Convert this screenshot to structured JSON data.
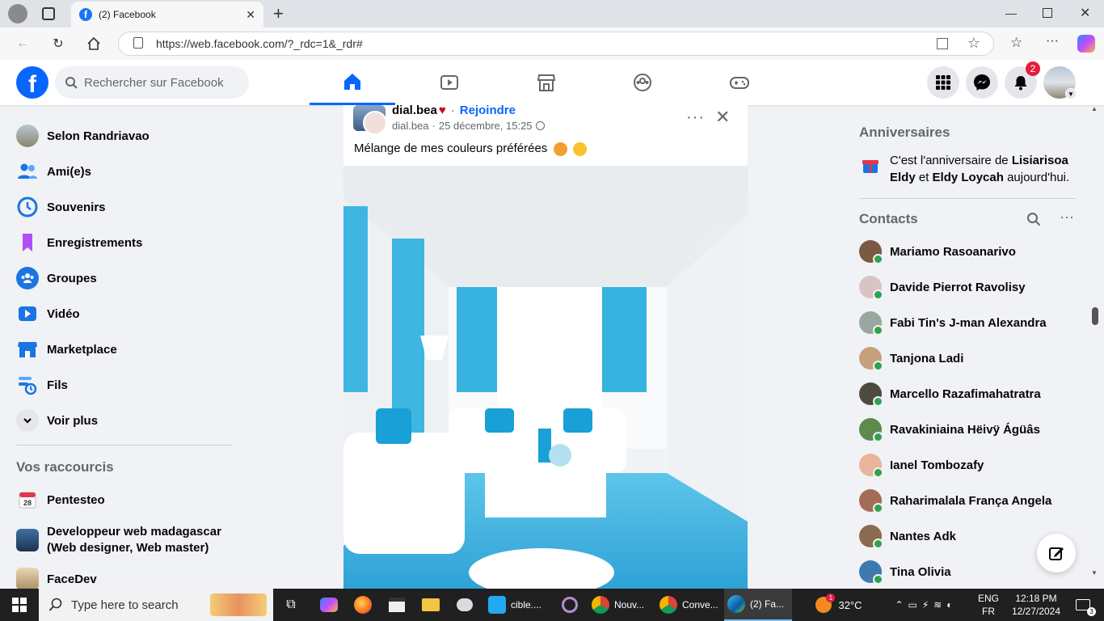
{
  "browser": {
    "tab_title": "(2) Facebook",
    "url": "https://web.facebook.com/?_rdc=1&_rdr#"
  },
  "fb": {
    "search_placeholder": "Rechercher sur Facebook",
    "notification_count": "2",
    "brand_color": "#0866ff"
  },
  "left_nav": {
    "items": [
      {
        "label": "Selon Randriavao",
        "icon": "profile-avatar"
      },
      {
        "label": "Ami(e)s",
        "icon": "friends-icon"
      },
      {
        "label": "Souvenirs",
        "icon": "memories-icon"
      },
      {
        "label": "Enregistrements",
        "icon": "saved-icon"
      },
      {
        "label": "Groupes",
        "icon": "groups-icon"
      },
      {
        "label": "Vidéo",
        "icon": "video-icon"
      },
      {
        "label": "Marketplace",
        "icon": "marketplace-icon"
      },
      {
        "label": "Fils",
        "icon": "feeds-icon"
      },
      {
        "label": "Voir plus",
        "icon": "chevron-down-icon"
      }
    ],
    "shortcuts_title": "Vos raccourcis",
    "shortcuts": [
      {
        "label": "Pentesteo",
        "icon": "calendar-icon"
      },
      {
        "label": "Developpeur web madagascar (Web designer, Web master)",
        "line1": "Developpeur web madagascar",
        "line2": "(Web designer, Web master)"
      },
      {
        "label": "FaceDev"
      }
    ]
  },
  "post": {
    "author": "dial.bea",
    "join_label": "Rejoindre",
    "meta_author": "dial.bea",
    "meta_date": "25 décembre, 15:25",
    "text": "Mélange de mes couleurs préférées"
  },
  "right": {
    "birthdays_title": "Anniversaires",
    "birthday_prefix": "C'est l'anniversaire de ",
    "birthday_name1": "Lisiarisoa Eldy",
    "birthday_and": " et ",
    "birthday_name2": "Eldy Loycah",
    "birthday_suffix": " aujourd'hui.",
    "contacts_title": "Contacts",
    "contacts": [
      "Mariamo Rasoanarivo",
      "Davide Pierrot Ravolisy",
      "Fabi Tin's J-man Alexandra",
      "Tanjona Ladi",
      "Marcello Razafimahatratra",
      "Ravakiniaina Hëivÿ Ágüâs",
      "Ianel Tombozafy",
      "Raharimalala França Angela",
      "Nantes Adk",
      "Tina Olivia"
    ]
  },
  "taskbar": {
    "search_placeholder": "Type here to search",
    "apps": [
      {
        "label": "cible....",
        "icon": "vscode-icon"
      },
      {
        "label": "Nouv...",
        "icon": "chrome-icon"
      },
      {
        "label": "Conve...",
        "icon": "chrome-icon"
      },
      {
        "label": "(2) Fa...",
        "icon": "edge-icon"
      }
    ],
    "temperature": "32°C",
    "weather_badge": "1",
    "lang1": "ENG",
    "lang2": "FR",
    "time": "12:18 PM",
    "date": "12/27/2024",
    "notifications": "3"
  }
}
